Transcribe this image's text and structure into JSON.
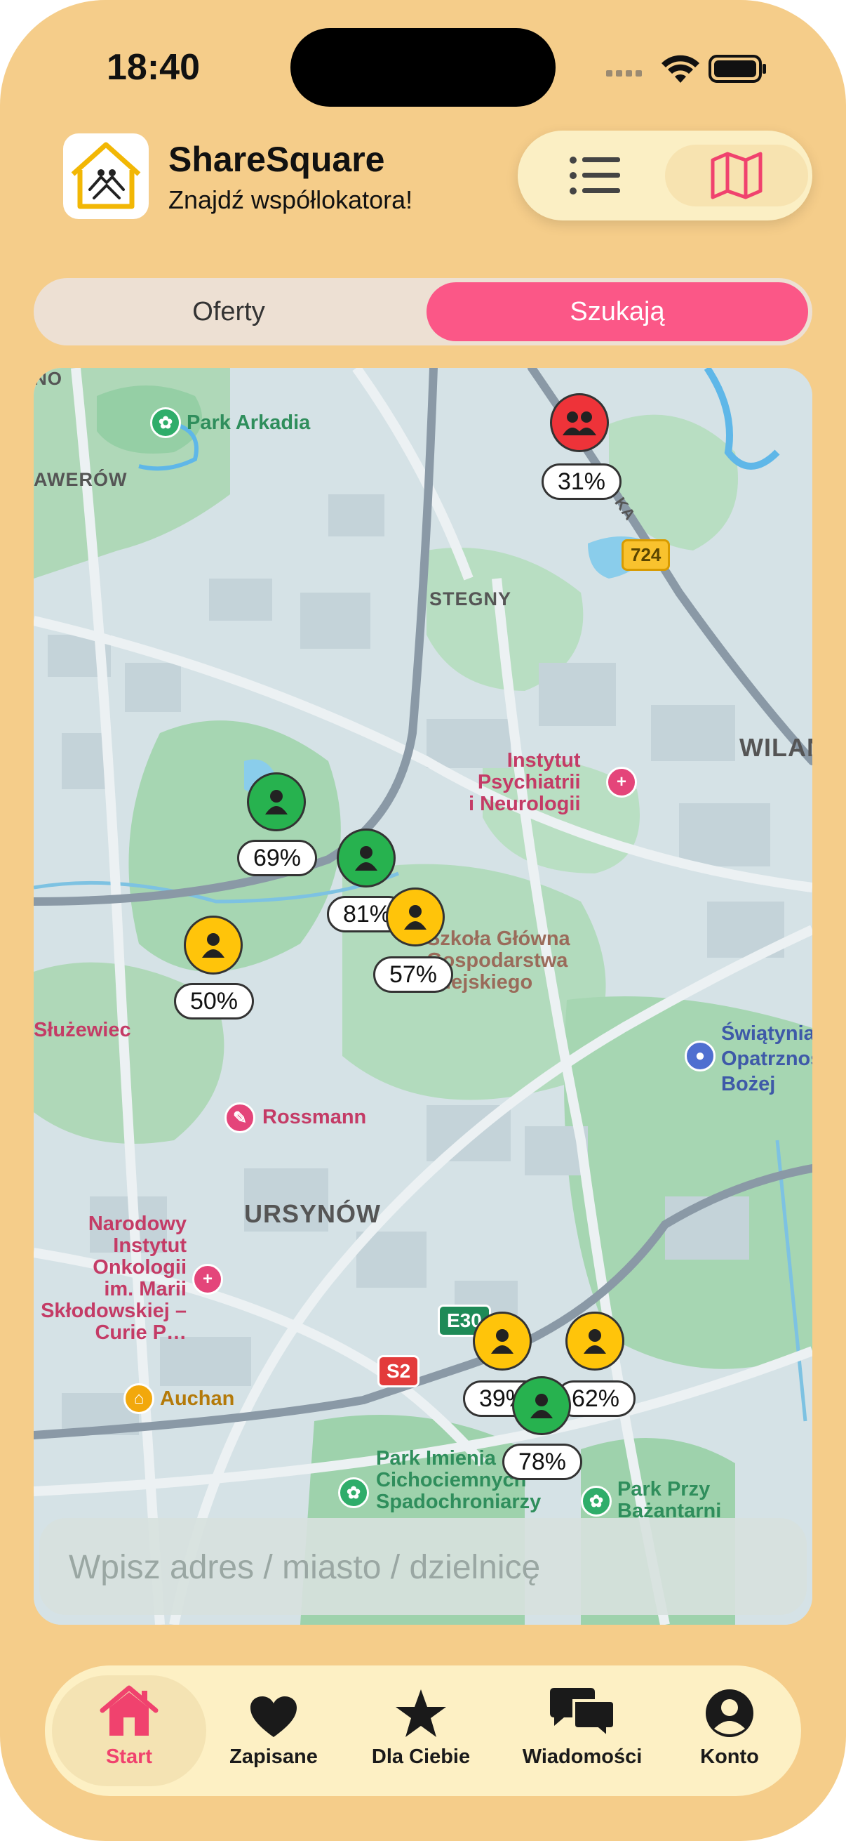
{
  "status": {
    "time": "18:40"
  },
  "app": {
    "title": "ShareSquare",
    "subtitle": "Znajdź współlokatora!"
  },
  "segments": {
    "offers": "Oferty",
    "seeking": "Szukają"
  },
  "search": {
    "placeholder": "Wpisz adres / miasto / dzielnicę"
  },
  "map": {
    "labels": {
      "park_arkadia": "Park Arkadia",
      "awerow": "AWERÓW",
      "no": "NO",
      "stegny": "STEGNY",
      "wilan": "WILAN",
      "ursynow": "URSYNÓW",
      "sluzewiec": "Służewiec",
      "instytut_psych": "Instytut\nPsychiatrii\ni Neurologii",
      "sggw": "Szkoła Główna\nGospodarstwa\nWiejskiego",
      "swiatynia": "Świątynia\nOpatrzności\nBożej",
      "rossmann": "Rossmann",
      "onkologia": "Narodowy\nInstytut\nOnkologii\nim. Marii\nSkłodowskiej –\nCurie P…",
      "auchan": "Auchan",
      "park_cichociemnych": "Park Imienia\nCichociemnych\nSpadochroniarzy",
      "park_bazantarni": "Park Przy\nBażantarni",
      "ka": "KA"
    },
    "road_badges": {
      "r724": "724",
      "e30": "E30",
      "s2": "S2"
    },
    "markers": [
      {
        "pct": "31%",
        "status": "red",
        "kind": "group"
      },
      {
        "pct": "69%",
        "status": "green",
        "kind": "single"
      },
      {
        "pct": "81%",
        "status": "green",
        "kind": "single"
      },
      {
        "pct": "57%",
        "status": "yellow",
        "kind": "single"
      },
      {
        "pct": "50%",
        "status": "yellow",
        "kind": "single"
      },
      {
        "pct": "39%",
        "status": "yellow",
        "kind": "single"
      },
      {
        "pct": "62%",
        "status": "yellow",
        "kind": "single"
      },
      {
        "pct": "78%",
        "status": "green",
        "kind": "single"
      }
    ]
  },
  "tabs": [
    {
      "label": "Start",
      "icon": "house-icon",
      "active": true
    },
    {
      "label": "Zapisane",
      "icon": "heart-icon"
    },
    {
      "label": "Dla Ciebie",
      "icon": "star-icon"
    },
    {
      "label": "Wiadomości",
      "icon": "chat-bubbles-icon"
    },
    {
      "label": "Konto",
      "icon": "person-circle-icon"
    }
  ],
  "colors": {
    "background": "#F5CD8A",
    "accent_pink": "#FB5787",
    "marker_green": "#27B24F",
    "marker_yellow": "#FFC40A",
    "marker_red": "#EE3339",
    "tab_active": "#F0426E"
  }
}
